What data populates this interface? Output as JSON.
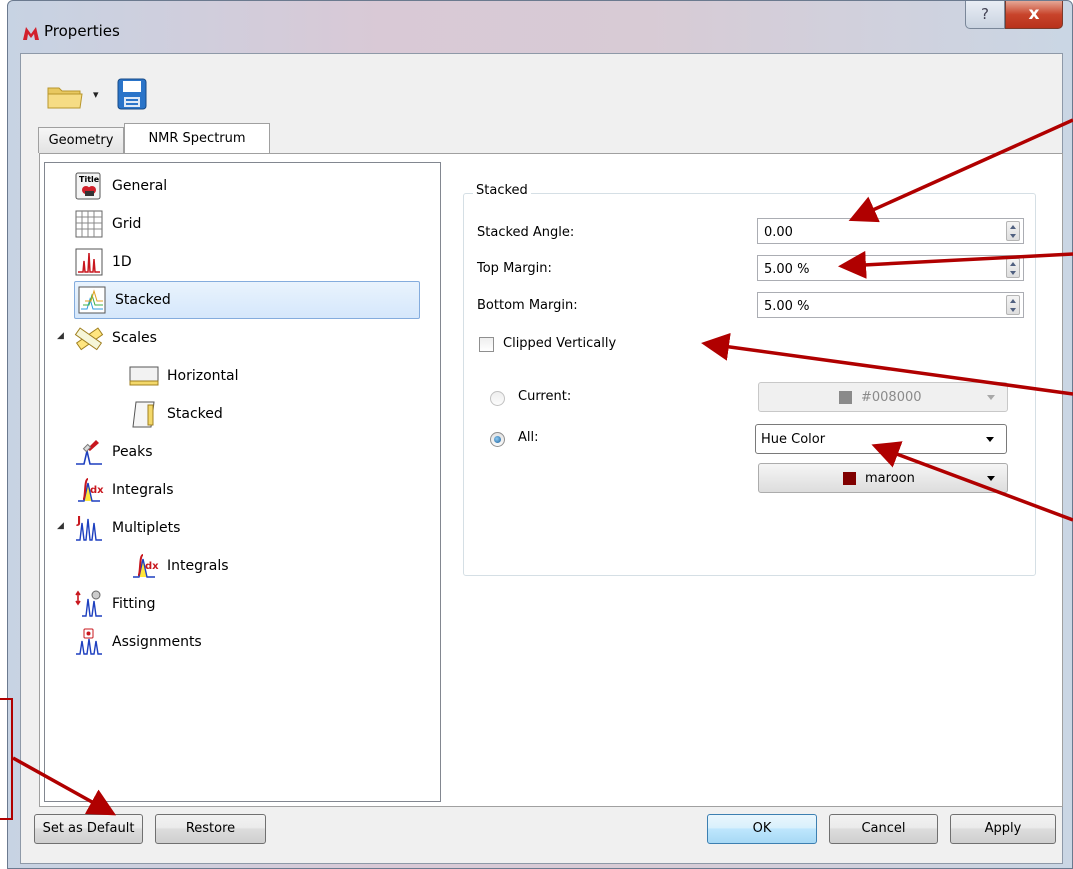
{
  "window": {
    "title": "Properties",
    "help_glyph": "?",
    "close_glyph": "x"
  },
  "toolbar": {
    "open_icon": "folder-open-icon",
    "save_icon": "floppy-save-icon",
    "dropdown_glyph": "▾"
  },
  "tabs": [
    {
      "label": "Geometry",
      "active": false
    },
    {
      "label": "NMR Spectrum",
      "active": true
    }
  ],
  "tree": {
    "items": [
      {
        "label": "General",
        "icon": "title-icon"
      },
      {
        "label": "Grid",
        "icon": "grid-icon"
      },
      {
        "label": "1D",
        "icon": "spectrum-1d-icon"
      },
      {
        "label": "Stacked",
        "icon": "stacked-icon",
        "selected": true
      },
      {
        "label": "Scales",
        "icon": "ruler-icon",
        "expanded": true
      },
      {
        "label": "Horizontal",
        "icon": "horizontal-scale-icon"
      },
      {
        "label": "Stacked",
        "icon": "vertical-scale-icon"
      },
      {
        "label": "Peaks",
        "icon": "peaks-icon"
      },
      {
        "label": "Integrals",
        "icon": "integrals-icon"
      },
      {
        "label": "Multiplets",
        "icon": "multiplets-icon",
        "expanded": true
      },
      {
        "label": "Integrals",
        "icon": "integrals-icon"
      },
      {
        "label": "Fitting",
        "icon": "fitting-icon"
      },
      {
        "label": "Assignments",
        "icon": "assignments-icon"
      }
    ]
  },
  "stacked": {
    "group_title": "Stacked",
    "angle_label": "Stacked Angle:",
    "angle_value": "0.00",
    "top_margin_label": "Top Margin:",
    "top_margin_value": "5.00 %",
    "bottom_margin_label": "Bottom Margin:",
    "bottom_margin_value": "5.00 %",
    "clipped_label": "Clipped Vertically",
    "clipped_checked": false,
    "current_label": "Current:",
    "current_color_value": "#008000",
    "current_swatch_color": "#8a8a8a",
    "all_label": "All:",
    "all_mode_value": "Hue Color",
    "all_color_value": "maroon",
    "all_swatch_color": "#800000",
    "selected_radio": "All"
  },
  "buttons": {
    "set_default": "Set as Default",
    "restore": "Restore",
    "ok": "OK",
    "cancel": "Cancel",
    "apply": "Apply"
  },
  "colors": {
    "annotation_red": "#b00000",
    "selection_blue": "#84acdd"
  }
}
